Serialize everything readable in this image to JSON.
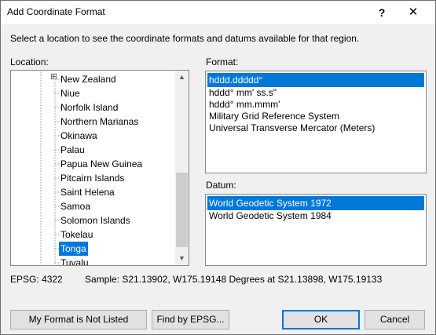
{
  "window": {
    "title": "Add Coordinate Format",
    "help": "?",
    "close": "✕"
  },
  "instruction": "Select a location to see the coordinate formats and datums available for that region.",
  "location": {
    "label": "Location:",
    "items": [
      {
        "label": "New Zealand",
        "expand": "⊞"
      },
      {
        "label": "Niue"
      },
      {
        "label": "Norfolk Island"
      },
      {
        "label": "Northern Marianas"
      },
      {
        "label": "Okinawa"
      },
      {
        "label": "Palau"
      },
      {
        "label": "Papua New Guinea"
      },
      {
        "label": "Pitcairn Islands"
      },
      {
        "label": "Saint Helena"
      },
      {
        "label": "Samoa"
      },
      {
        "label": "Solomon Islands"
      },
      {
        "label": "Tokelau"
      },
      {
        "label": "Tonga"
      },
      {
        "label": "Tuvalu"
      }
    ],
    "selected": "Tonga",
    "scroll_up": "▲",
    "scroll_down": "▼"
  },
  "format": {
    "label": "Format:",
    "items": [
      "hddd.ddddd°",
      "hddd° mm' ss.s\"",
      "hddd° mm.mmm'",
      "Military Grid Reference System",
      "Universal Transverse Mercator (Meters)"
    ],
    "selected": "hddd.ddddd°"
  },
  "datum": {
    "label": "Datum:",
    "items": [
      "World Geodetic System 1972",
      "World Geodetic System 1984"
    ],
    "selected": "World Geodetic System 1972"
  },
  "status": {
    "epsg": "EPSG: 4322",
    "sample": "Sample: S21.13902, W175.19148 Degrees at S21.13898, W175.19133"
  },
  "buttons": {
    "not_listed": "My Format is Not Listed",
    "find_epsg": "Find by EPSG...",
    "ok": "OK",
    "cancel": "Cancel"
  },
  "colors": {
    "selection": "#0078d7",
    "title_bar": "#ffffff",
    "dialog_background": "#f0f0f0"
  }
}
